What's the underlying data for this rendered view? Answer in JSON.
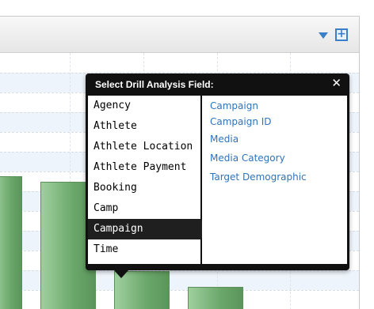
{
  "header": {
    "expand_symbol": "+",
    "icons": [
      "chevron-down-icon",
      "expand-plus-icon"
    ]
  },
  "popup": {
    "title": "Select Drill Analysis Field:",
    "close_symbol": "✕",
    "left_items": [
      {
        "label": "Agency",
        "selected": false
      },
      {
        "label": "Athlete",
        "selected": false
      },
      {
        "label": "Athlete Location",
        "selected": false
      },
      {
        "label": "Athlete Payment",
        "selected": false
      },
      {
        "label": "Booking",
        "selected": false
      },
      {
        "label": "Camp",
        "selected": false
      },
      {
        "label": "Campaign",
        "selected": true
      },
      {
        "label": "Time",
        "selected": false
      }
    ],
    "right_items": [
      {
        "label": "Campaign"
      },
      {
        "label": "Campaign ID"
      },
      {
        "label": "Media"
      },
      {
        "label": "Media Category"
      },
      {
        "label": "Target Demographic"
      }
    ]
  },
  "colors": {
    "accent": "#3a7fc7",
    "link": "#2f73b8",
    "bar_green": "#6aa76a",
    "popup_bg": "#111111"
  }
}
